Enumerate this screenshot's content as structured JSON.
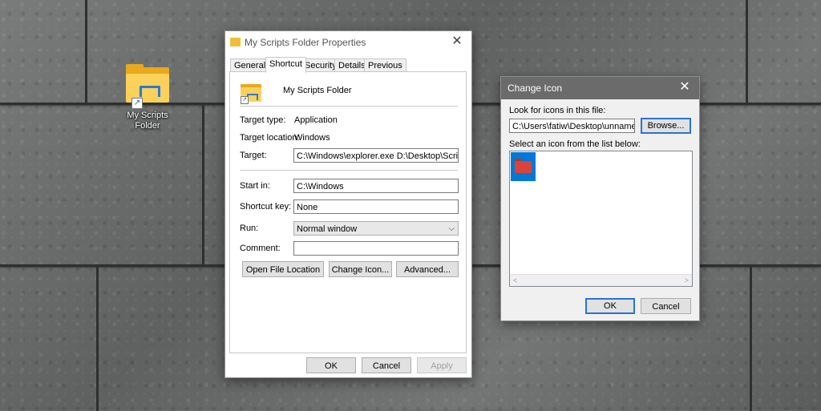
{
  "desktop": {
    "icon_label_line1": "My Scripts",
    "icon_label_line2": "Folder"
  },
  "properties": {
    "title": "My Scripts Folder Properties",
    "tabs": [
      "General",
      "Shortcut",
      "Security",
      "Details",
      "Previous Versions"
    ],
    "active_tab": "Shortcut",
    "name": "My Scripts Folder",
    "target_type_label": "Target type:",
    "target_type_value": "Application",
    "target_location_label": "Target location:",
    "target_location_value": "Windows",
    "target_label": "Target:",
    "target_value": "C:\\Windows\\explorer.exe D:\\Desktop\\Scripts",
    "start_in_label": "Start in:",
    "start_in_value": "C:\\Windows",
    "shortcut_key_label": "Shortcut key:",
    "shortcut_key_value": "None",
    "run_label": "Run:",
    "run_value": "Normal window",
    "comment_label": "Comment:",
    "comment_value": "",
    "open_file_location": "Open File Location",
    "change_icon": "Change Icon...",
    "advanced": "Advanced...",
    "ok": "OK",
    "cancel": "Cancel",
    "apply": "Apply"
  },
  "change_icon": {
    "title": "Change Icon",
    "look_for_label": "Look for icons in this file:",
    "file_value": "C:\\Users\\fatiw\\Desktop\\unnamed_cy",
    "browse": "Browse...",
    "select_label": "Select an icon from the list below:",
    "ok": "OK",
    "cancel": "Cancel"
  },
  "colors": {
    "selection": "#0078d7",
    "default_button_border": "#2a73d0",
    "folder_yellow": "#fbd15b",
    "icon_red": "#d9433c"
  },
  "icons": {
    "close": "close-icon",
    "dropdown": "chevron-down-icon",
    "scroll_left": "arrow-left-icon",
    "scroll_right": "arrow-right-icon"
  }
}
